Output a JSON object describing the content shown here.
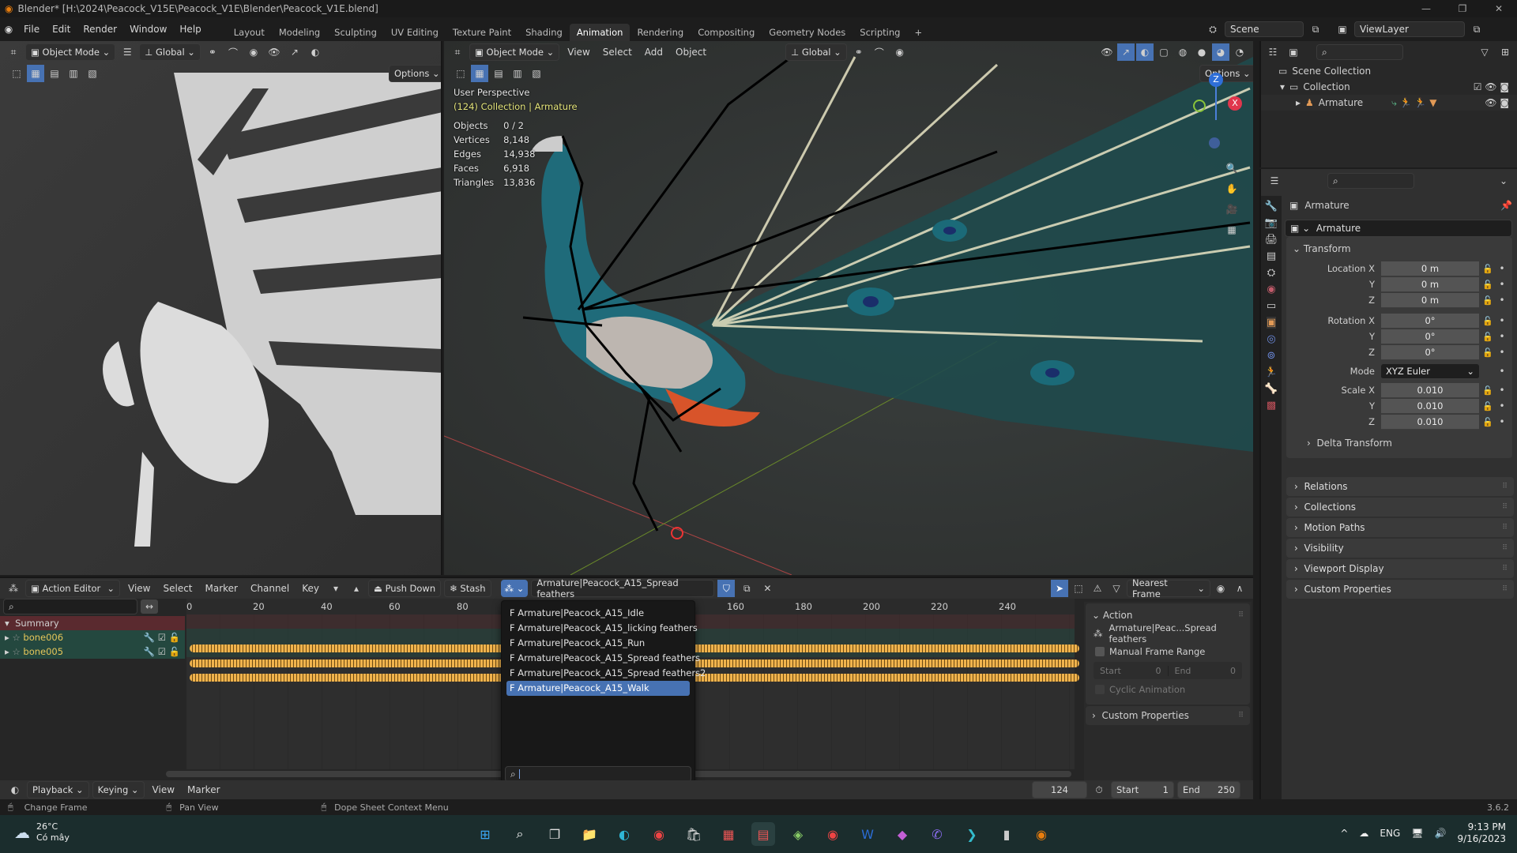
{
  "titlebar": {
    "title": "Blender* [H:\\2024\\Peacock_V15E\\Peacock_V1E\\Blender\\Peacock_V1E.blend]",
    "minimize": "—",
    "maximize": "❐",
    "close": "✕"
  },
  "menu": [
    "File",
    "Edit",
    "Render",
    "Window",
    "Help"
  ],
  "workspaces": [
    "Layout",
    "Modeling",
    "Sculpting",
    "UV Editing",
    "Texture Paint",
    "Shading",
    "Animation",
    "Rendering",
    "Compositing",
    "Geometry Nodes",
    "Scripting",
    "+"
  ],
  "active_workspace": "Animation",
  "scene": {
    "label": "Scene",
    "view_layer": "ViewLayer"
  },
  "viewport_left": {
    "mode": "Object Mode",
    "orientation": "Global",
    "options": "Options"
  },
  "viewport_right": {
    "mode": "Object Mode",
    "menus": [
      "View",
      "Select",
      "Add",
      "Object"
    ],
    "orientation": "Global",
    "options": "Options",
    "perspective": "User Perspective",
    "context": "(124) Collection | Armature",
    "stats": [
      {
        "k": "Objects",
        "v": "0 / 2"
      },
      {
        "k": "Vertices",
        "v": "8,148"
      },
      {
        "k": "Edges",
        "v": "14,938"
      },
      {
        "k": "Faces",
        "v": "6,918"
      },
      {
        "k": "Triangles",
        "v": "13,836"
      }
    ],
    "gizmo": {
      "z": "Z",
      "x": "X"
    }
  },
  "outliner": {
    "scene_collection": "Scene Collection",
    "collection": "Collection",
    "armature": "Armature"
  },
  "properties": {
    "object_name": "Armature",
    "datablock": "Armature",
    "transform_title": "Transform",
    "location": {
      "label": "Location X",
      "x": "0 m",
      "y": "0 m",
      "z": "0 m"
    },
    "rotation": {
      "label": "Rotation X",
      "x": "0°",
      "y": "0°",
      "z": "0°"
    },
    "mode_label": "Mode",
    "mode": "XYZ Euler",
    "scale": {
      "label": "Scale X",
      "x": "0.010",
      "y": "0.010",
      "z": "0.010"
    },
    "axis_y": "Y",
    "axis_z": "Z",
    "delta": "Delta Transform",
    "panels": [
      "Relations",
      "Collections",
      "Motion Paths",
      "Visibility",
      "Viewport Display",
      "Custom Properties"
    ]
  },
  "dopesheet": {
    "editor": "Action Editor",
    "menus": [
      "View",
      "Select",
      "Marker",
      "Channel",
      "Key"
    ],
    "push_down": "Push Down",
    "stash": "Stash",
    "action": "Armature|Peacock_A15_Spread feathers",
    "snap": "Nearest Frame",
    "ruler": [
      "0",
      "20",
      "40",
      "60",
      "80",
      "160",
      "180",
      "200",
      "220",
      "240"
    ],
    "channels": [
      {
        "name": "Summary"
      },
      {
        "name": "bone006"
      },
      {
        "name": "bone005"
      }
    ],
    "action_panel": {
      "title": "Action",
      "action_name": "Armature|Peac...Spread feathers",
      "manual_range": "Manual Frame Range",
      "start_label": "Start",
      "start": "0",
      "end_label": "End",
      "end": "0",
      "cyclic": "Cyclic Animation",
      "custom": "Custom Properties"
    }
  },
  "action_popup": {
    "items": [
      "F Armature|Peacock_A15_Idle",
      "F Armature|Peacock_A15_licking feathers",
      "F Armature|Peacock_A15_Run",
      "F Armature|Peacock_A15_Spread feathers",
      "F Armature|Peacock_A15_Spread feathers2",
      "F Armature|Peacock_A15_Walk"
    ],
    "selected_index": 5,
    "search_value": ""
  },
  "timeline": {
    "menus": [
      "Playback",
      "Keying",
      "View",
      "Marker"
    ],
    "current_frame": "124",
    "start_label": "Start",
    "start": "1",
    "end_label": "End",
    "end": "250"
  },
  "statusbar": {
    "hints": [
      "Change Frame",
      "Pan View",
      "Dope Sheet Context Menu"
    ],
    "version": "3.6.2"
  },
  "taskbar": {
    "weather_temp": "26°C",
    "weather_desc": "Có mây",
    "lang": "ENG",
    "time": "9:13 PM",
    "date": "9/16/2023"
  }
}
